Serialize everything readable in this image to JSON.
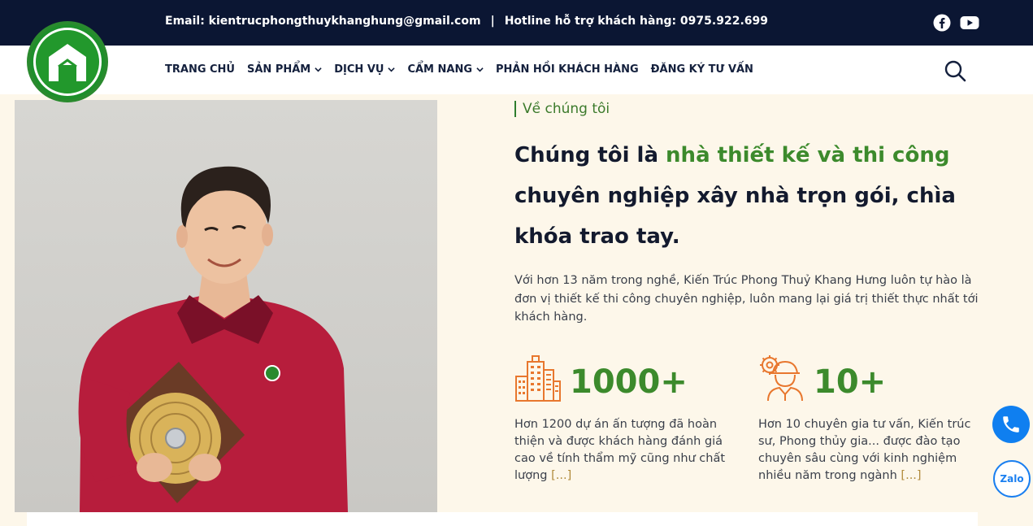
{
  "topbar": {
    "email_label": "Email: kientrucphongthuykhanghung@gmail.com",
    "separator": "|",
    "hotline_label": "Hotline hỗ trợ khách hàng: 0975.922.699",
    "social_icons": [
      "facebook-icon",
      "youtube-icon"
    ]
  },
  "nav": {
    "items": [
      {
        "label": "TRANG CHỦ",
        "has_dropdown": false
      },
      {
        "label": "SẢN PHẨM",
        "has_dropdown": true
      },
      {
        "label": "DỊCH VỤ",
        "has_dropdown": true
      },
      {
        "label": "CẨM NANG",
        "has_dropdown": true
      },
      {
        "label": "PHẢN HỒI KHÁCH HÀNG",
        "has_dropdown": false
      },
      {
        "label": "ĐĂNG KÝ TƯ VẤN",
        "has_dropdown": false
      }
    ]
  },
  "about": {
    "eyebrow": "Về chúng tôi",
    "heading_prefix": "Chúng tôi là ",
    "heading_highlight": "nhà thiết kế và thi công",
    "heading_suffix": "chuyên nghiệp xây nhà trọn gói, chìa khóa trao tay.",
    "intro": "Với hơn 13 năm trong nghề, Kiến Trúc Phong Thuỷ Khang Hưng luôn tự hào là đơn vị thiết kế thi công chuyên nghiệp, luôn mang lại giá trị thiết thực nhất tới khách hàng."
  },
  "stats": [
    {
      "icon": "buildings-icon",
      "number": "1000+",
      "description": "Hơn 1200 dự án ấn tượng đã hoàn thiện và được khách hàng đánh giá cao về tính thẩm mỹ cũng như chất lượng",
      "more": "[...]"
    },
    {
      "icon": "engineer-icon",
      "number": "10+",
      "description": "Hơn 10 chuyên gia tư vấn, Kiến trúc sư, Phong thủy gia... được đào tạo chuyên sâu cùng với kinh nghiệm nhiều năm trong ngành",
      "more": "[...]"
    }
  ],
  "floating": {
    "zalo_label": "Zalo"
  },
  "colors": {
    "topbar_bg": "#0b1633",
    "accent_green": "#3c8a2c",
    "icon_orange": "#e8772e",
    "content_bg": "#fdf7ea",
    "phone_blue": "#0f7ff0"
  }
}
